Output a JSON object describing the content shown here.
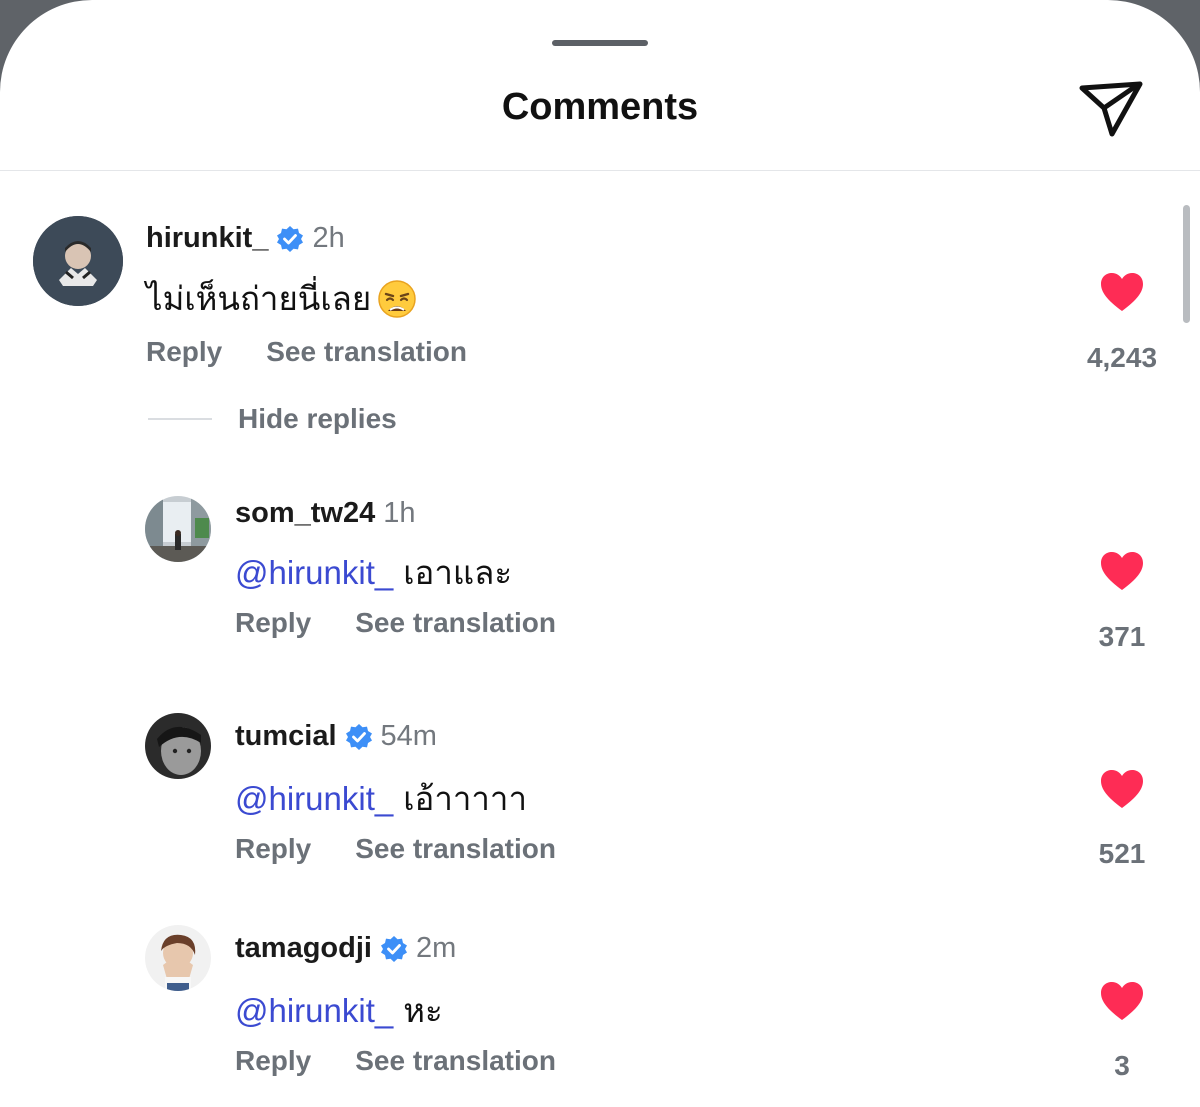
{
  "header": {
    "title": "Comments"
  },
  "labels": {
    "reply": "Reply",
    "see_translation": "See translation",
    "hide_replies": "Hide replies"
  },
  "comments": [
    {
      "username": "hirunkit_",
      "verified": true,
      "time": "2h",
      "text": "ไม่เห็นถ่ายนี่เลย",
      "emoji": "weary-face",
      "likes": "4,243",
      "liked": true
    },
    {
      "username": "som_tw24",
      "verified": false,
      "time": "1h",
      "mention": "@hirunkit_",
      "text": "เอาและ",
      "likes": "371",
      "liked": true
    },
    {
      "username": "tumcial",
      "verified": true,
      "time": "54m",
      "mention": "@hirunkit_",
      "text": "เอ้าาาาา",
      "likes": "521",
      "liked": true
    },
    {
      "username": "tamagodji",
      "verified": true,
      "time": "2m",
      "mention": "@hirunkit_",
      "text": "หะ",
      "likes": "3",
      "liked": true
    }
  ],
  "colors": {
    "heart": "#fe2c55",
    "verified": "#3d8ff7",
    "mention": "#3b4ad1"
  }
}
